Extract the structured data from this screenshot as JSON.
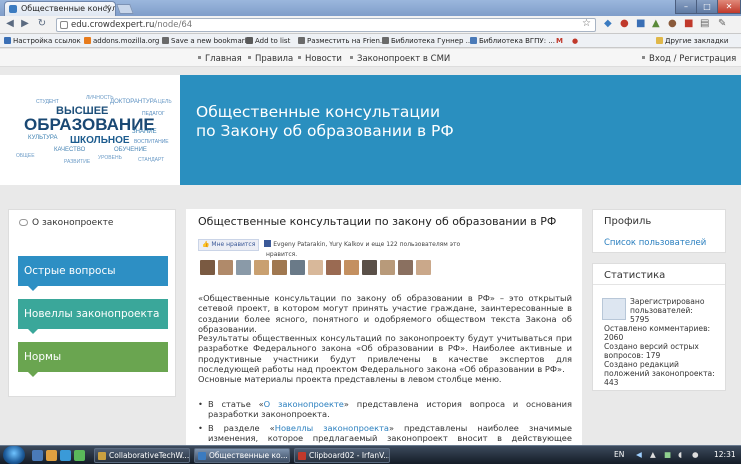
{
  "browser": {
    "tab_title": "Общественные консульт...",
    "url_host": "edu.crowdexpert.ru",
    "url_path": "/node/64"
  },
  "bookmarks": [
    {
      "label": "Настройка ссылок",
      "color": "#3a6fb5"
    },
    {
      "label": "addons.mozilla.org",
      "color": "#e77b1c"
    },
    {
      "label": "Save a new bookmark",
      "color": "#6a6a6a"
    },
    {
      "label": "Add to list",
      "color": "#5a5a5a"
    },
    {
      "label": "Разместить на Frien...",
      "color": "#6a6a6a"
    },
    {
      "label": "Библиотека Гуннер ...",
      "color": "#6a6a6a"
    },
    {
      "label": "Библиотека ВГПУ: ...",
      "color": "#4a7ab8"
    },
    {
      "label": "Другие закладки",
      "color": "#e0b84a"
    }
  ],
  "topnav": {
    "items": [
      "Главная",
      "Правила",
      "Новости",
      "Законопроект в СМИ"
    ],
    "login": "Вход / Регистрация"
  },
  "banner": {
    "title_line1": "Общественные консультации",
    "title_line2": "по Закону об образовании в РФ",
    "cloud": [
      "ВЫСШЕЕ",
      "ОБРАЗОВАНИЕ",
      "ШКОЛЬНОЕ",
      "КУЛЬТУРА",
      "КАЧЕСТВО",
      "ОБУЧЕНИЕ",
      "ДОКТОРАНТУРА",
      "СТУДЕНТ",
      "ЛИЧНОСТЬ",
      "УРОВЕНЬ",
      "ОБЩЕЕ",
      "ЦЕЛЬ",
      "ЗНАНИЕ",
      "ВОСПИТАНИЕ",
      "ПЕДАГОГ",
      "РАЗВИТИЕ",
      "СТАНДАРТ"
    ]
  },
  "sidebar": {
    "heading": "О законопроекте",
    "buttons": [
      "Острые вопросы",
      "Новеллы законопроекта",
      "Нормы"
    ]
  },
  "main": {
    "title": "Общественные консультации по закону об образовании в РФ",
    "like_button": "Мне нравится",
    "like_text_line1": "Evgeny Patarakin, Yury Kalkov и еще 122 пользователям это",
    "like_text_line2": "нравится.",
    "p1": "«Общественные консультации по закону об образовании в РФ» – это открытый сетевой проект, в котором могут принять участие граждане, заинтересованные в создании более ясного, понятного и одобряемого обществом текста Закона об образовании.",
    "p2": "Результаты общественных консультаций по законопроекту будут учитываться при разработке Федерального закона «Об образовании в РФ». Наиболее активные и продуктивные участники будут привлечены в качестве экспертов для последующей работы над проектом Федерального закона «Об образовании в РФ».",
    "p3": "Основные материалы проекта представлены в левом столбце меню.",
    "li1_pre": "В статье «",
    "li1_link": "О законопроекте",
    "li1_post": "» представлена история вопроса и основания разработки законопроекта.",
    "li2_pre": "В разделе «",
    "li2_link": "Новеллы законопроекта",
    "li2_post": "» представлены наиболее значимые изменения, которое предлагаемый законопроект вносит в действующее законодательство. Здесь можно комментировать и оценивать новеллы и комментарии к ним других участников. Обсуждения"
  },
  "profile": {
    "heading": "Профиль",
    "link": "Список пользователей"
  },
  "stats": {
    "heading": "Статистика",
    "line1": "Зарегистрировано",
    "line2": "пользователей:",
    "line3": "5795",
    "line4": "Оставлено комментариев:",
    "line5": "2060",
    "line6": "Создано версий острых",
    "line7": "вопросов: 179",
    "line8": "Создано редакций",
    "line9": "положений законопроекта:",
    "line10": "443"
  },
  "taskbar": {
    "tasks": [
      "CollaborativeTechW...",
      "Общественные ко...",
      "Clipboard02 - IrfanV..."
    ],
    "lang": "EN",
    "time": "12:31"
  }
}
